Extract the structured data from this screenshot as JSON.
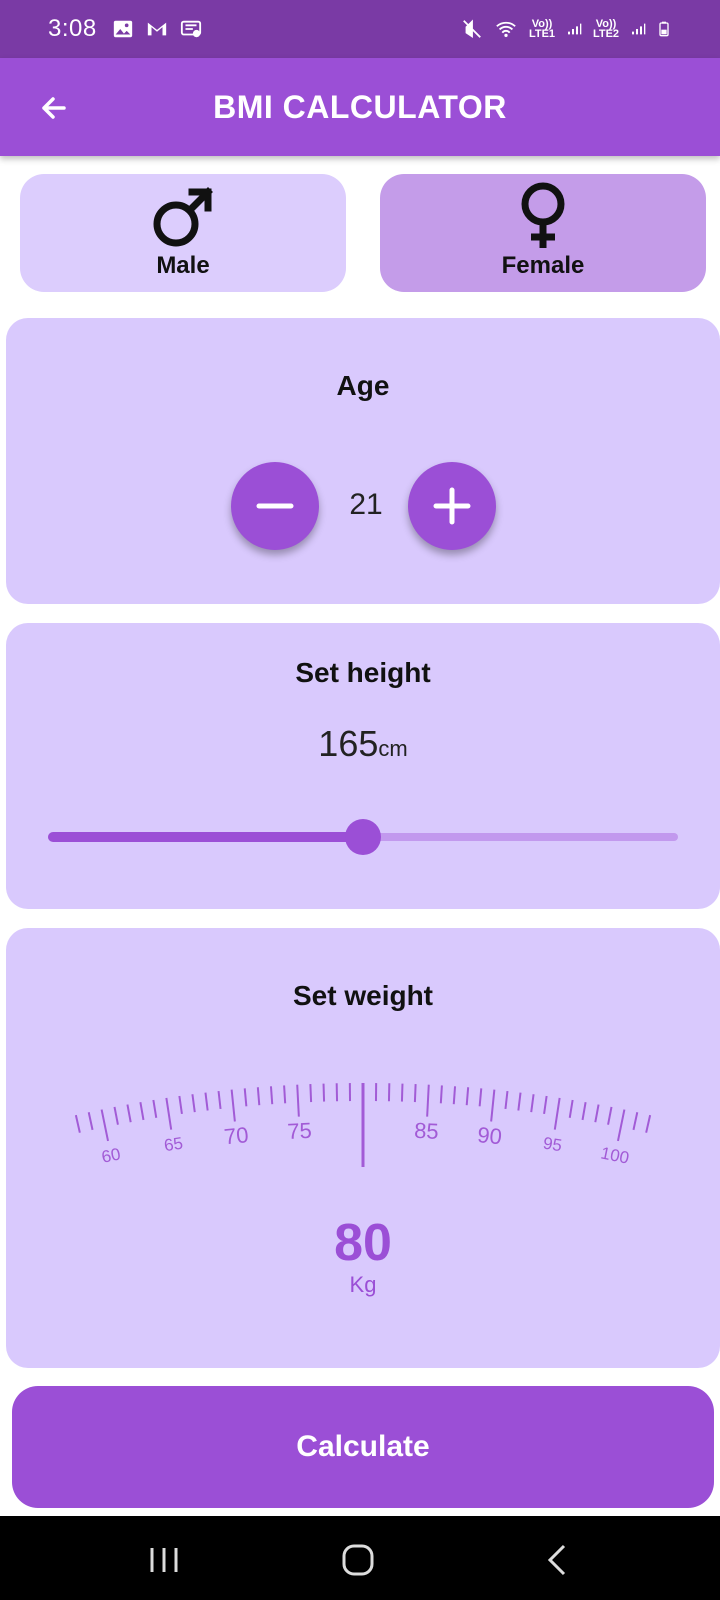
{
  "status_bar": {
    "time": "3:08",
    "left_icons": [
      "image-icon",
      "gmail-icon",
      "message-icon"
    ],
    "right_icons": [
      "mute-icon",
      "wifi-icon",
      "lte1-signal-icon",
      "lte2-signal-icon",
      "battery-icon"
    ],
    "lte1_label": "Vo)) LTE1",
    "lte2_label": "Vo)) LTE2"
  },
  "app_bar": {
    "title": "BMI CALCULATOR",
    "back_icon": "arrow-left-icon"
  },
  "gender": {
    "male_label": "Male",
    "female_label": "Female",
    "selected": "Female",
    "male_icon": "male-symbol-icon",
    "female_icon": "female-symbol-icon"
  },
  "age": {
    "title": "Age",
    "value": "21",
    "decrement_icon": "minus-icon",
    "increment_icon": "plus-icon"
  },
  "height": {
    "title": "Set height",
    "value": "165",
    "unit": "cm",
    "slider_fraction": 0.5
  },
  "weight": {
    "title": "Set weight",
    "value": "80",
    "unit": "Kg",
    "scale_labels": [
      "60",
      "65",
      "70",
      "75",
      "85",
      "90",
      "95",
      "100"
    ]
  },
  "calculate_label": "Calculate",
  "nav": {
    "recents_icon": "recents-icon",
    "home_icon": "home-icon",
    "back_icon": "back-chevron-icon"
  },
  "colors": {
    "primary": "#9b4fd6",
    "status_bar": "#7a3aa5",
    "card": "#d9c9fd",
    "male_card": "#dccdfd",
    "female_card_selected": "#c49ce9",
    "slider_track": "#c299ee"
  }
}
